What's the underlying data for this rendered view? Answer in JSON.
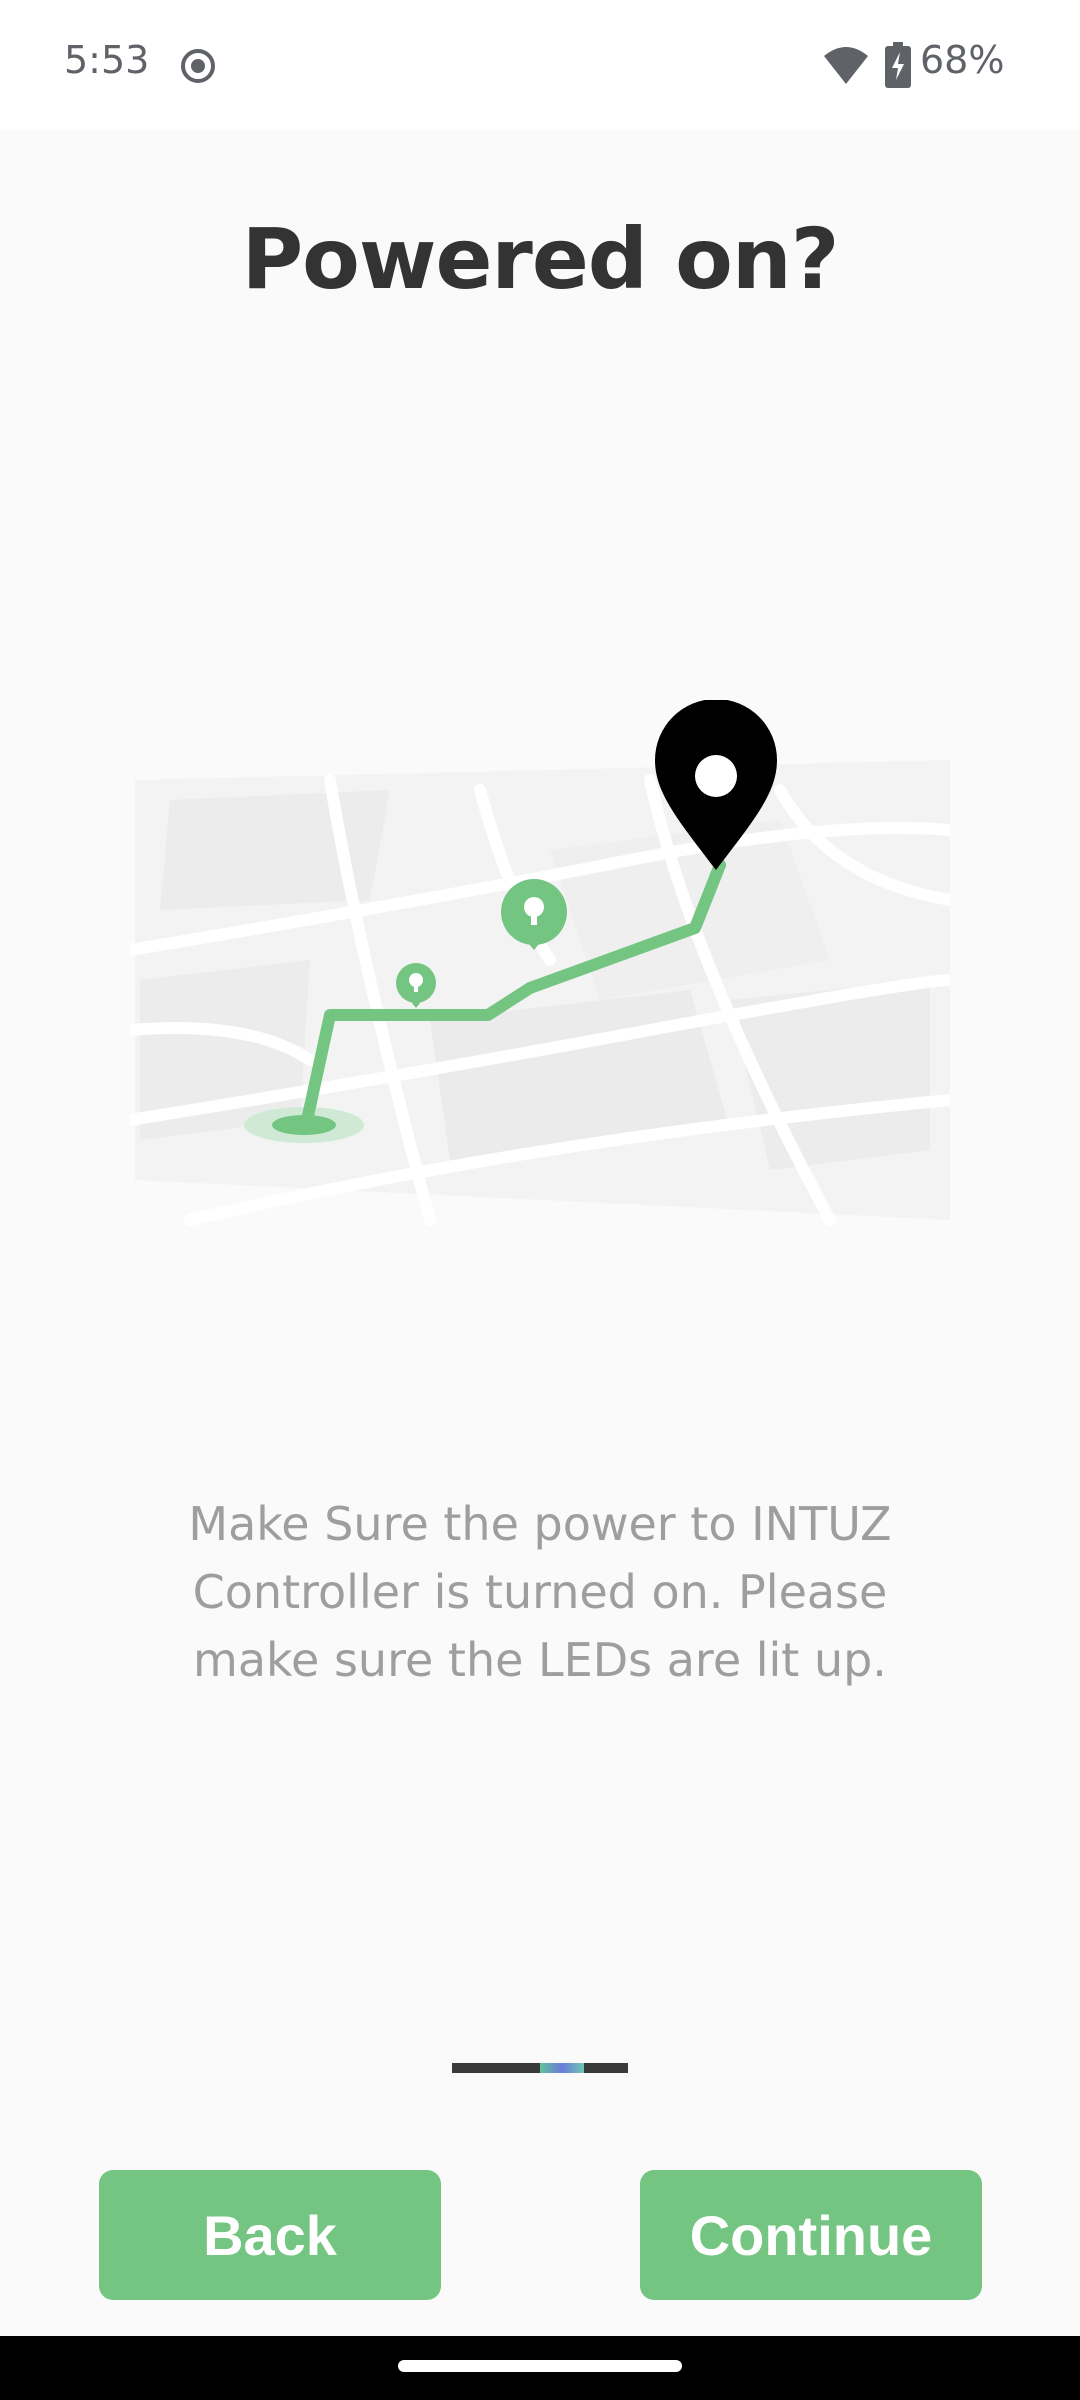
{
  "status_bar": {
    "time": "5:53",
    "battery": "68%",
    "icons": [
      "record-icon",
      "wifi-icon",
      "battery-charging-icon"
    ]
  },
  "title": "Powered on?",
  "description": "Make Sure the power to INTUZ Controller is turned on. Please make sure the LEDs are lit up.",
  "illustration": {
    "icons": [
      "map-icon",
      "location-pin-icon",
      "bulb-marker-icon"
    ]
  },
  "pager": {
    "total_segments": 3,
    "active_index": 1
  },
  "buttons": {
    "back": "Back",
    "continue": "Continue"
  },
  "colors": {
    "accent": "#74c582",
    "title": "#333333",
    "description": "#9e9e9e",
    "background": "#fafafa"
  }
}
